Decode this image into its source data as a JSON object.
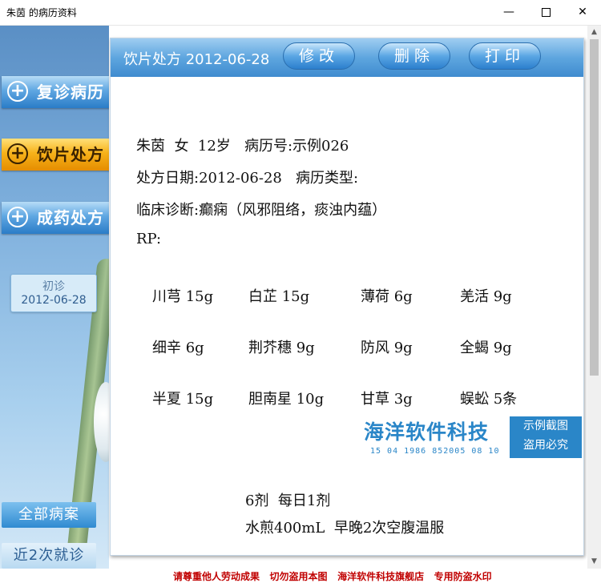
{
  "window": {
    "title": "朱茵 的病历资料",
    "min_icon": "minimize-icon",
    "max_icon": "maximize-icon",
    "close_icon": "close-icon"
  },
  "sidebar": {
    "nav": [
      {
        "label": "复诊病历",
        "icon": "plus-circle-icon",
        "active": false
      },
      {
        "label": "饮片处方",
        "icon": "plus-circle-icon",
        "active": true
      },
      {
        "label": "成药处方",
        "icon": "plus-circle-icon",
        "active": false
      }
    ],
    "visit": {
      "type": "初诊",
      "date": "2012-06-28"
    },
    "all_cases": "全部病案",
    "recent": "近2次就诊"
  },
  "panel": {
    "title": "饮片处方 2012-06-28",
    "buttons": {
      "edit": "修改",
      "delete": "删除",
      "print": "打印"
    },
    "patient_line": "朱茵  女  12岁   病历号:示例026",
    "date_line": "处方日期:2012-06-28   病历类型:",
    "diagnosis_line": "临床诊断:癫痫（风邪阻络，痰浊内蕴）",
    "rp": "RP:",
    "herbs": [
      [
        "川芎 15g",
        "白芷 15g",
        "薄荷 6g",
        "羌活 9g"
      ],
      [
        "细辛 6g",
        "荆芥穗 9g",
        "防风 9g",
        "全蝎 9g"
      ],
      [
        "半夏 15g",
        "胆南星 10g",
        "甘草 3g",
        "蜈蚣 5条"
      ]
    ],
    "dosage": "6剂  每日1剂",
    "method": "水煎400mL  早晚2次空腹温服"
  },
  "watermark": {
    "name": "海洋软件科技",
    "code": "15 04 1986 852005 08 10",
    "stamp_line1": "示例截图",
    "stamp_line2": "盗用必究"
  },
  "footer": "请尊重他人劳动成果   切勿盗用本图   海洋软件科技旗舰店   专用防盗水印"
}
